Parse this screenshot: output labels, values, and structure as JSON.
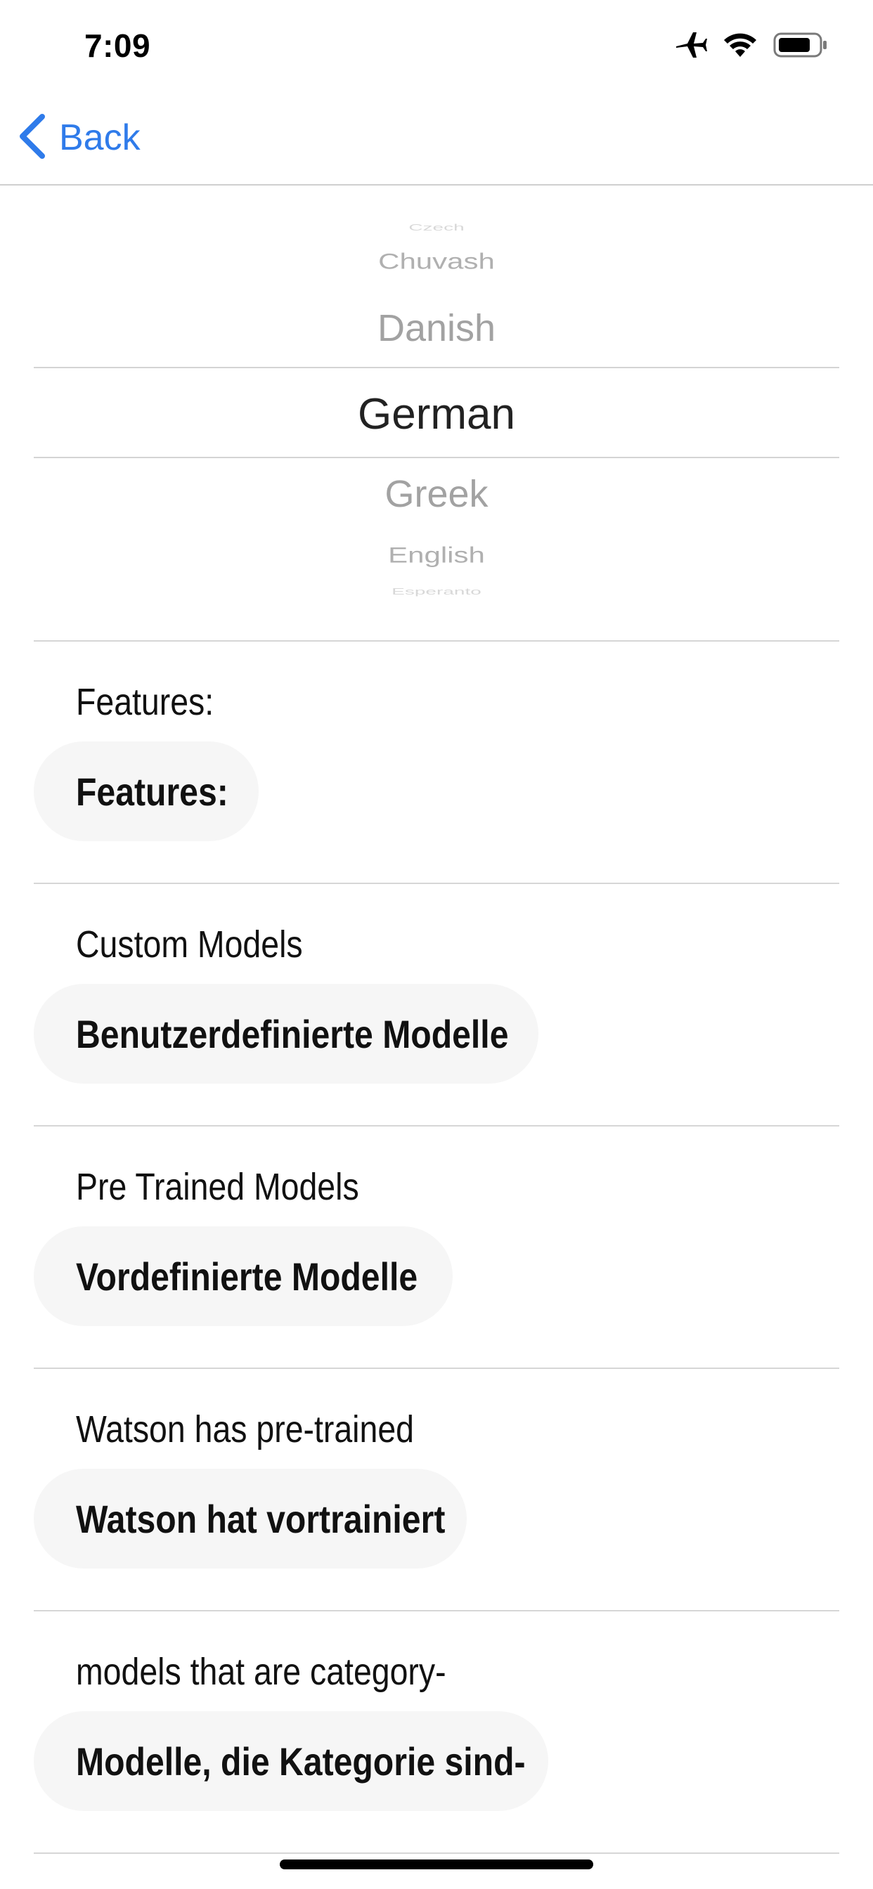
{
  "status_bar": {
    "time": "7:09",
    "icons": [
      "airplane-icon",
      "wifi-icon",
      "battery-icon"
    ]
  },
  "nav": {
    "back_label": "Back",
    "accent_color": "#2f7bea"
  },
  "picker": {
    "items": [
      "Czech",
      "Chuvash",
      "Danish",
      "German",
      "Greek",
      "English",
      "Esperanto"
    ],
    "selected": "German"
  },
  "translations": [
    {
      "source": "Features:",
      "translated": "Features:"
    },
    {
      "source": "Custom Models",
      "translated": "Benutzerdefinierte Modelle"
    },
    {
      "source": "Pre Trained Models",
      "translated": "Vordefinierte Modelle"
    },
    {
      "source": "Watson has pre-trained",
      "translated": "Watson hat vortrainiert"
    },
    {
      "source": "models that are category-",
      "translated": "Modelle, die Kategorie sind-"
    }
  ]
}
